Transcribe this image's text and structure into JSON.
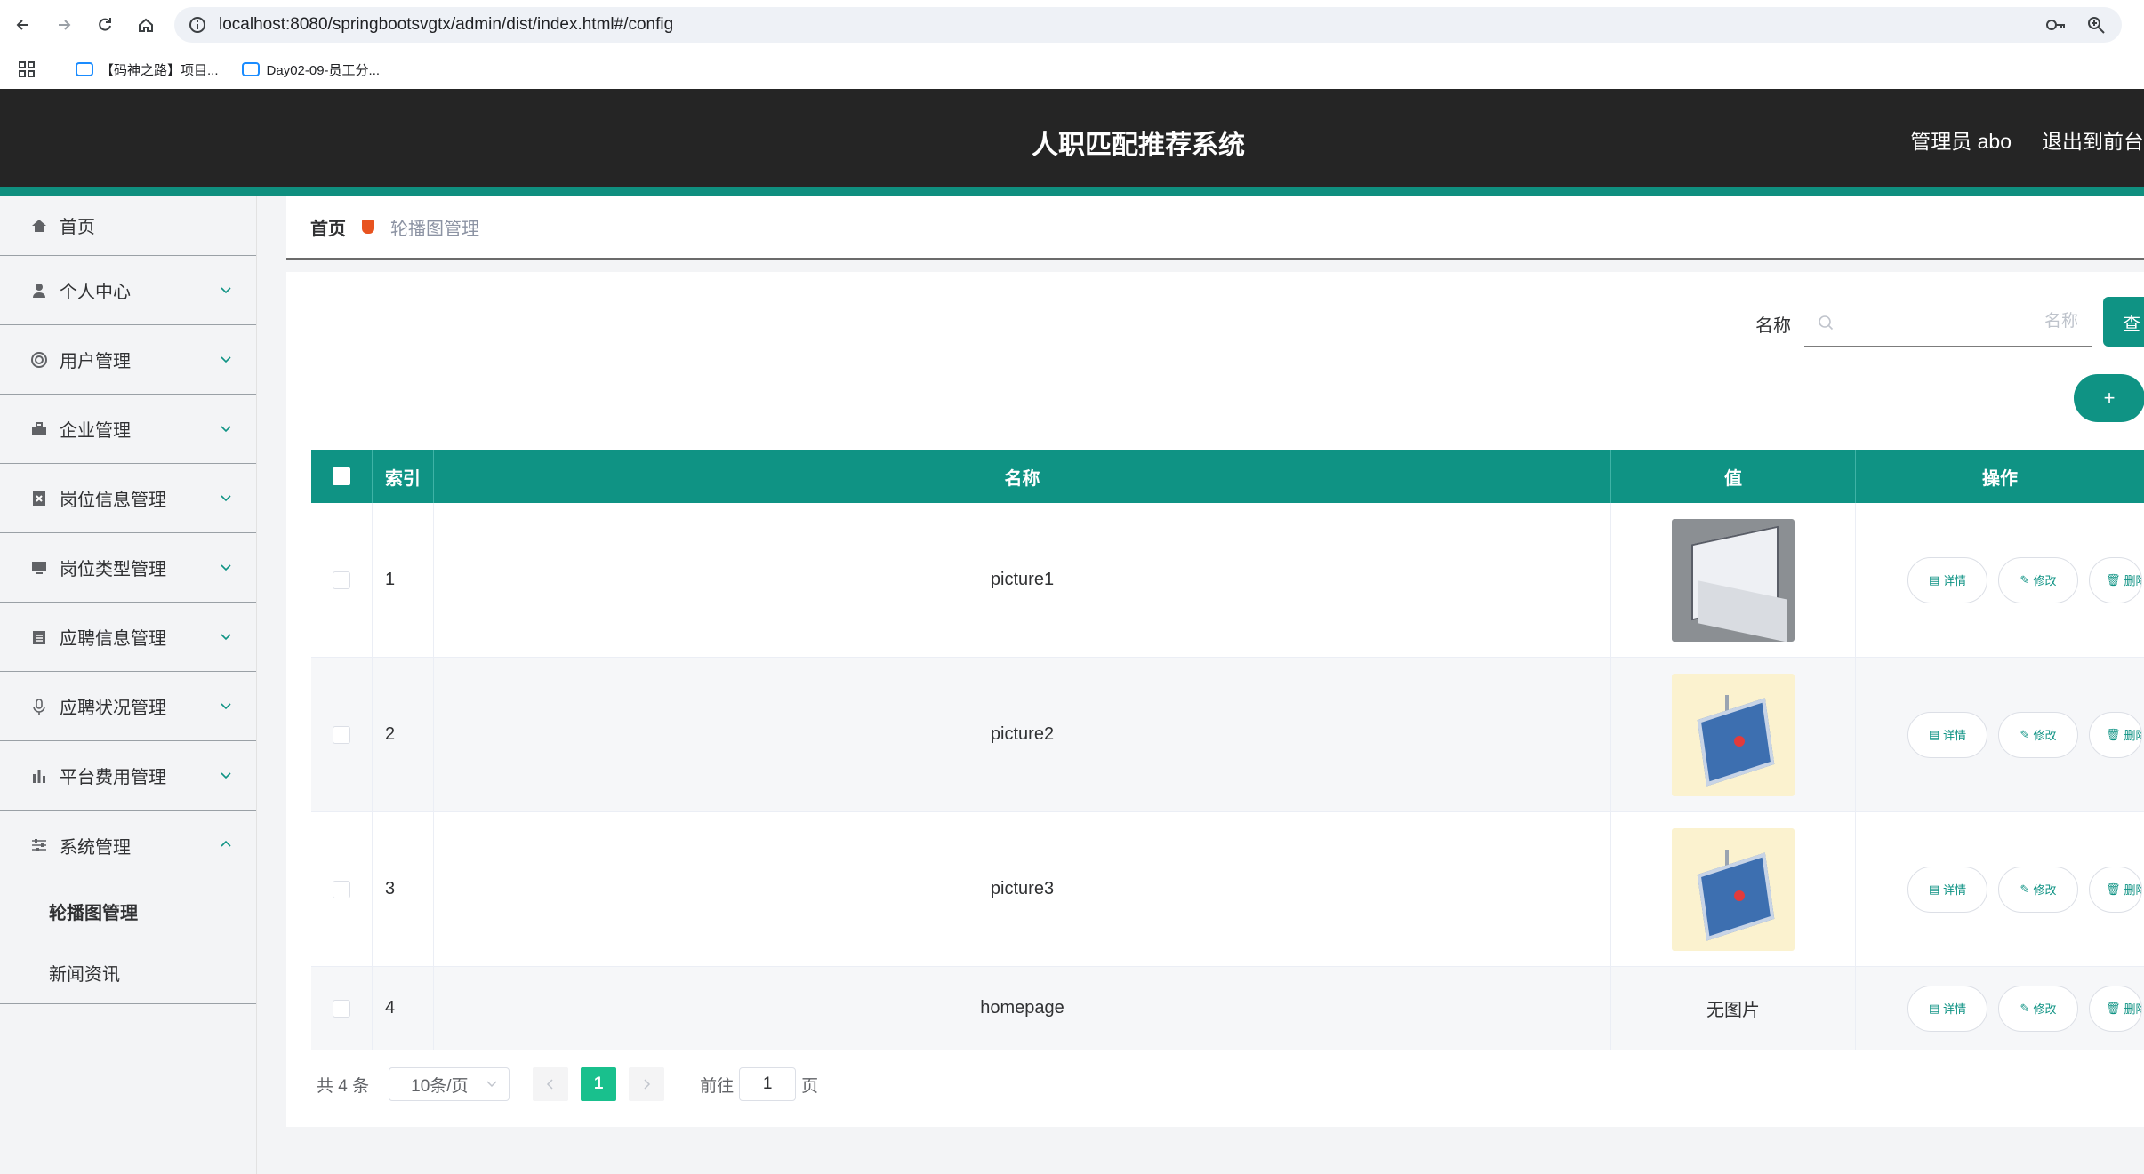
{
  "browser": {
    "url": "localhost:8080/springbootsvgtx/admin/dist/index.html#/config",
    "bookmarks": [
      "【码神之路】项目...",
      "Day02-09-员工分..."
    ]
  },
  "header": {
    "title": "人职匹配推荐系统",
    "user": "管理员 abo",
    "exit": "退出到前台"
  },
  "sidebar": {
    "items": [
      {
        "label": "首页",
        "icon": "home-icon"
      },
      {
        "label": "个人中心",
        "icon": "user-icon"
      },
      {
        "label": "用户管理",
        "icon": "lifebuoy-icon"
      },
      {
        "label": "企业管理",
        "icon": "briefcase-icon"
      },
      {
        "label": "岗位信息管理",
        "icon": "close-box-icon"
      },
      {
        "label": "岗位类型管理",
        "icon": "monitor-icon"
      },
      {
        "label": "应聘信息管理",
        "icon": "clipboard-icon"
      },
      {
        "label": "应聘状况管理",
        "icon": "microphone-icon"
      },
      {
        "label": "平台费用管理",
        "icon": "bar-chart-icon"
      },
      {
        "label": "系统管理",
        "icon": "sliders-icon"
      }
    ],
    "submenu": [
      "轮播图管理",
      "新闻资讯"
    ]
  },
  "breadcrumb": {
    "home": "首页",
    "current": "轮播图管理"
  },
  "search": {
    "label": "名称",
    "placeholder": "名称",
    "button": "查",
    "add": "+"
  },
  "table": {
    "headers": [
      "索引",
      "名称",
      "值",
      "操作"
    ],
    "rows": [
      {
        "index": "1",
        "name": "picture1",
        "value": "image"
      },
      {
        "index": "2",
        "name": "picture2",
        "value": "image"
      },
      {
        "index": "3",
        "name": "picture3",
        "value": "image"
      },
      {
        "index": "4",
        "name": "homepage",
        "value": "无图片"
      }
    ],
    "actions": [
      "详情",
      "修改",
      "删除"
    ]
  },
  "pagination": {
    "total": "共 4 条",
    "page_size": "10条/页",
    "current": "1",
    "goto_label": "前往",
    "goto_value": "1",
    "page_unit": "页"
  },
  "colors": {
    "primary": "#0f9384",
    "header_bg": "#252525",
    "active_page": "#19c08d"
  }
}
